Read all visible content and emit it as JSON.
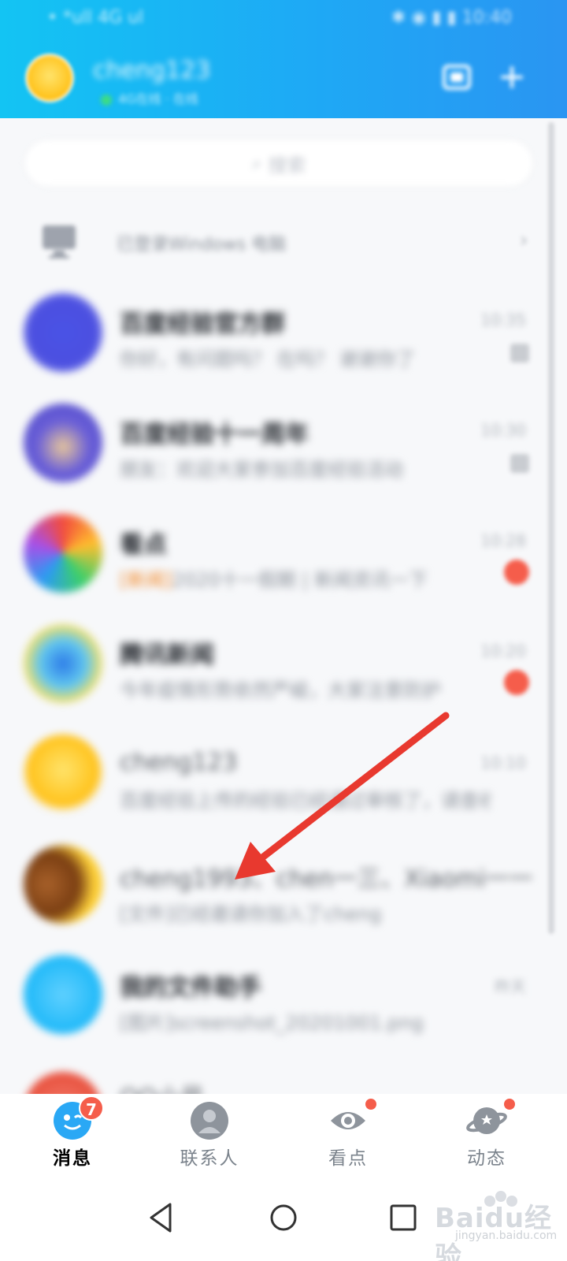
{
  "status_bar": {
    "left": "• *ull 4G ul",
    "right": "✱ ◉ ▮ ▮ 10:40"
  },
  "profile": {
    "name": "cheng123",
    "status": "4G在线 · 在线"
  },
  "search": {
    "placeholder": "搜索"
  },
  "device": {
    "text": "已登录Windows 电脑"
  },
  "conversations": [
    {
      "name": "百度经验官方群",
      "preview": "你好，有问题吗？ 在吗？ 谢谢你了",
      "time": "10:35"
    },
    {
      "name": "百度经验十一周年",
      "preview": "朋友：欢迎大家参加百度经验活动",
      "time": "10:30"
    },
    {
      "name": "看点",
      "preview_tag": "[新闻]",
      "preview": "2020十一假期 | 新闻资讯一下",
      "time": "10:28"
    },
    {
      "name": "腾讯新闻",
      "preview": "今年疫情形势依然严峻，大家注意防护",
      "time": "10:20"
    },
    {
      "name": "cheng123",
      "preview": "百度经验上传的经验已经通过审核了，请查收",
      "time": "10:10"
    },
    {
      "name": "cheng1993、chen一三、Xiaomi一一",
      "preview": "[文件]已经邀请你加入了cheng",
      "time": ""
    },
    {
      "name": "我的文件助手",
      "preview": "[图片]screenshot_20201001.png",
      "time": "昨天"
    },
    {
      "name": "QQ小号",
      "preview": "",
      "time": ""
    }
  ],
  "tabs": [
    {
      "label": "消息",
      "count": "7"
    },
    {
      "label": "联系人"
    },
    {
      "label": "看点"
    },
    {
      "label": "动态"
    }
  ],
  "watermark": {
    "main": "Baidu经验",
    "sub": "jingyan.baidu.com"
  },
  "colors": {
    "header": "#1ea9f5",
    "badge": "#f55d4b",
    "arrow": "#e8392f"
  }
}
